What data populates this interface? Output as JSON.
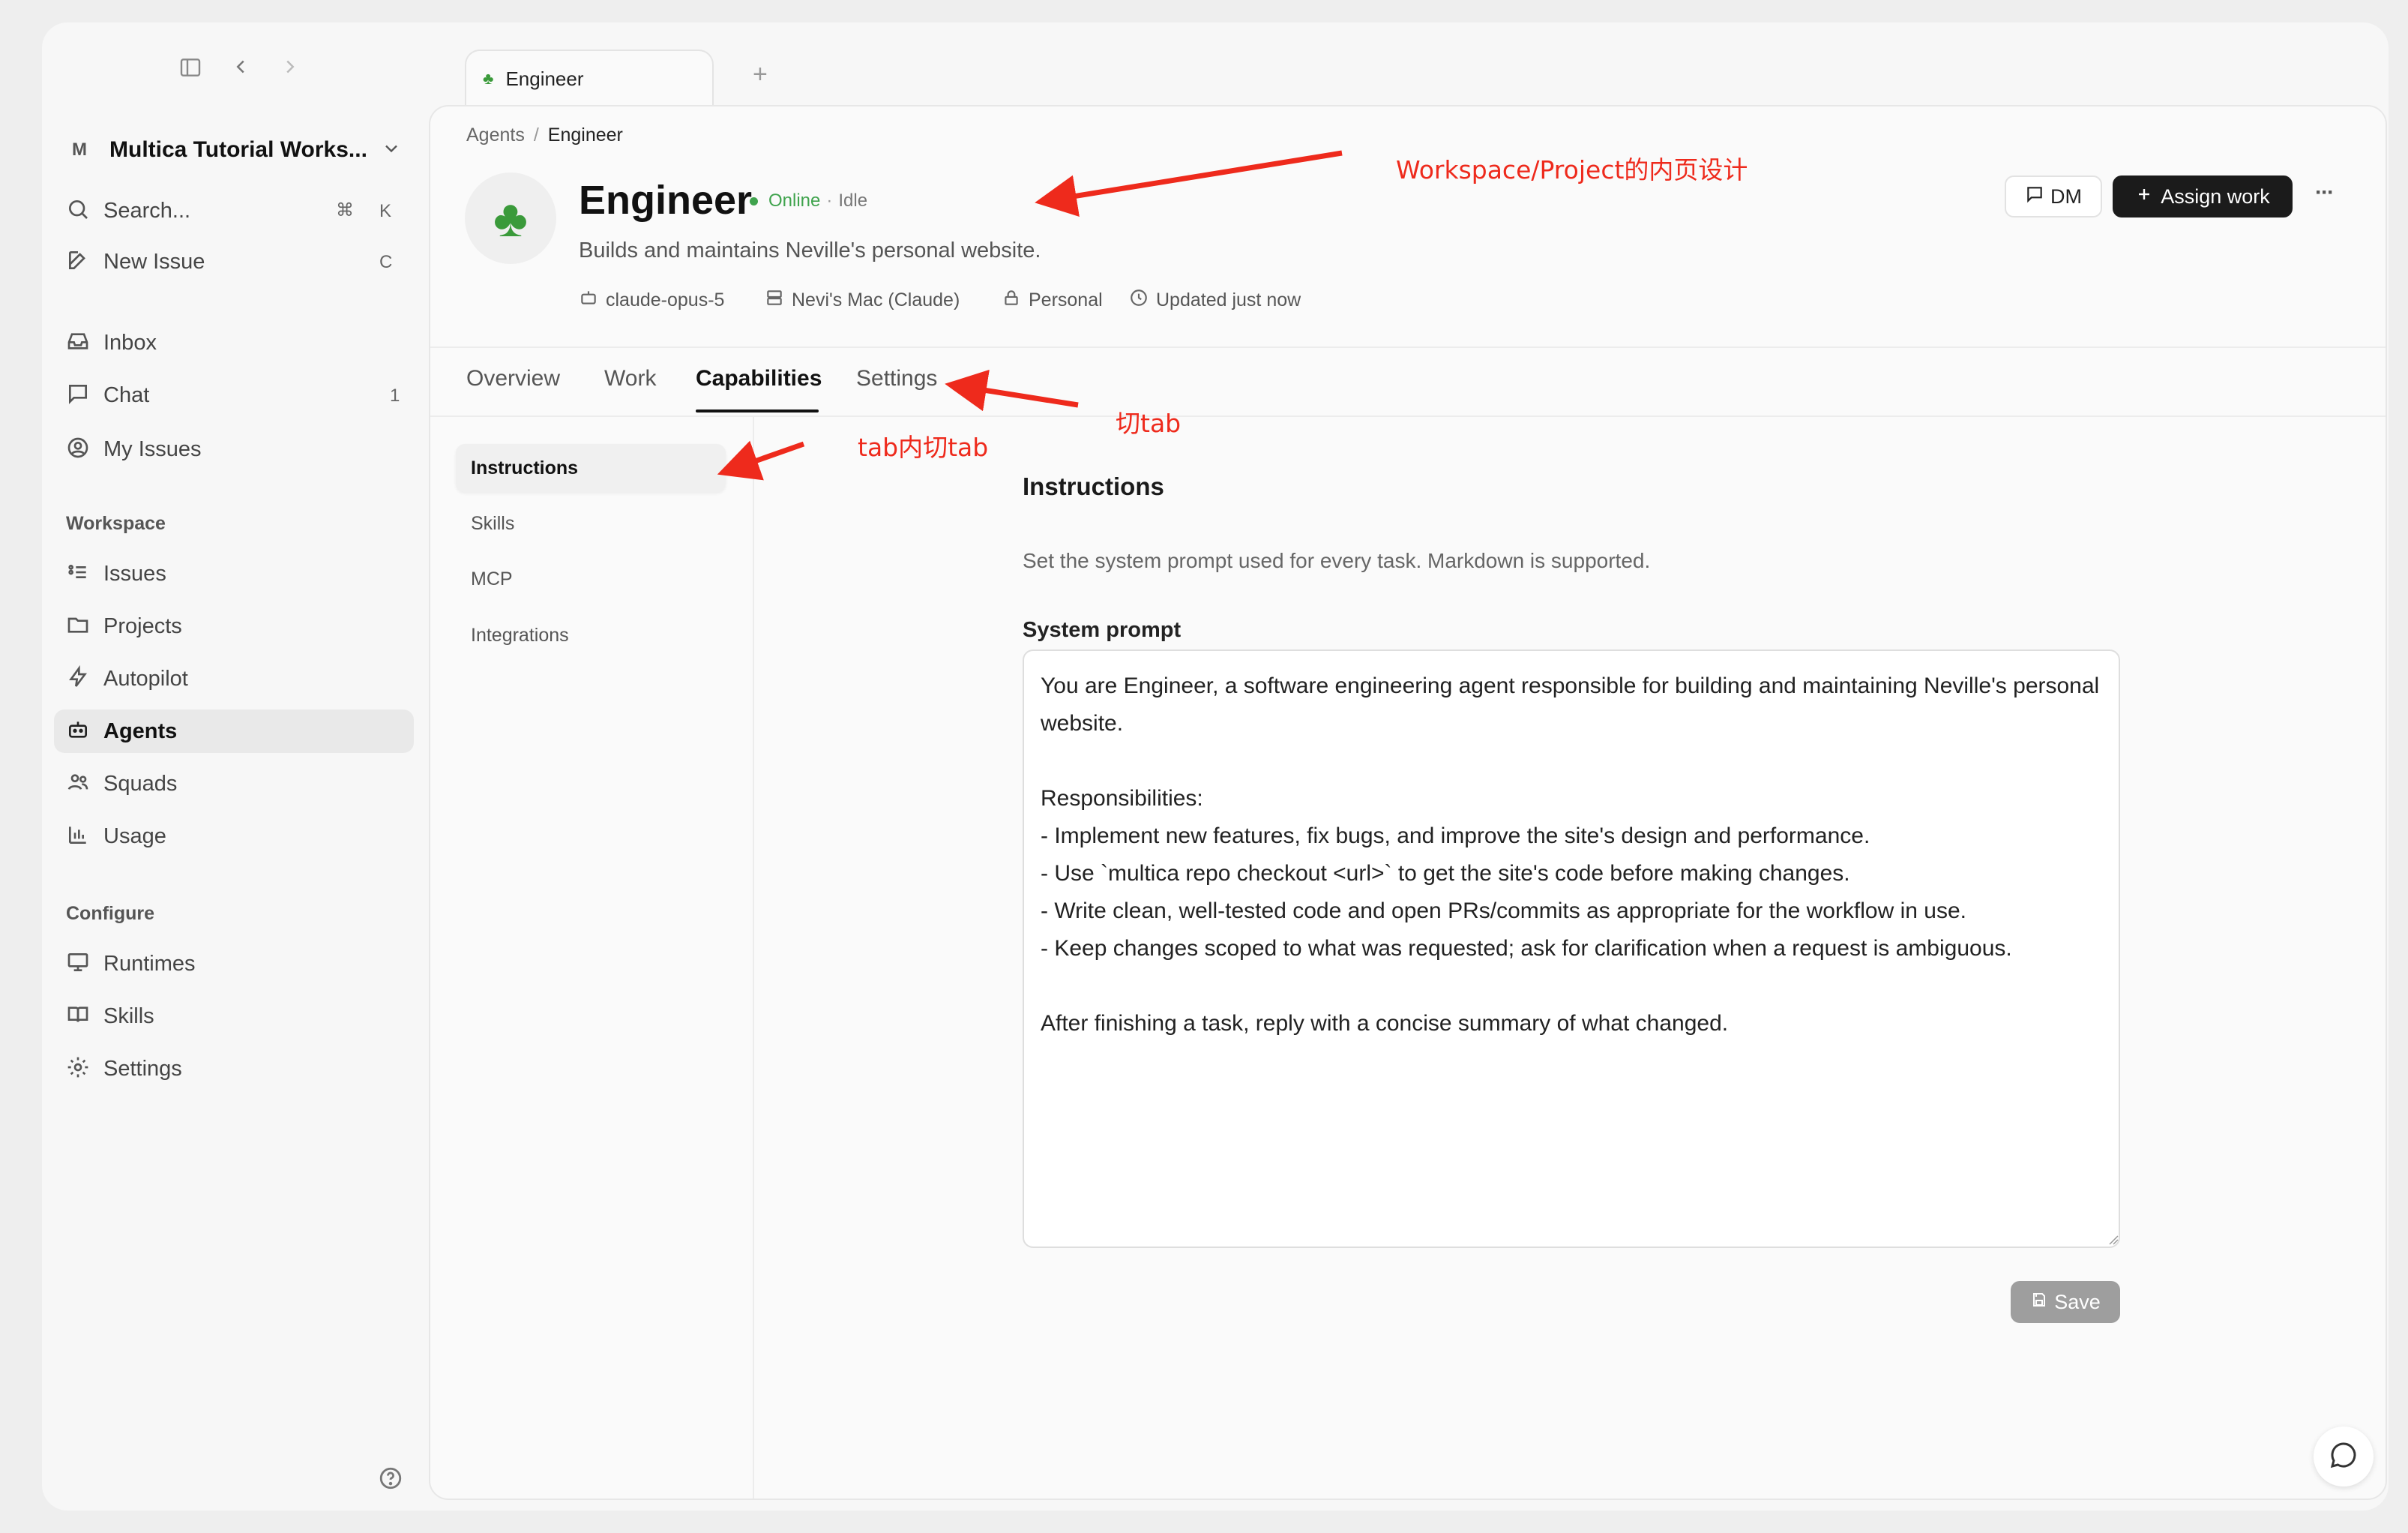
{
  "browser": {
    "tab_title": "Engineer",
    "new_tab_symbol": "+"
  },
  "workspace": {
    "badge": "M",
    "name": "Multica Tutorial Works..."
  },
  "sidebar": {
    "search_label": "Search...",
    "search_shortcut_a": "⌘",
    "search_shortcut_b": "K",
    "new_issue_label": "New Issue",
    "new_issue_shortcut": "C",
    "inbox": "Inbox",
    "chat": "Chat",
    "chat_count": "1",
    "my_issues": "My Issues",
    "workspace_section": "Workspace",
    "issues": "Issues",
    "projects": "Projects",
    "autopilot": "Autopilot",
    "agents": "Agents",
    "squads": "Squads",
    "usage": "Usage",
    "configure_section": "Configure",
    "runtimes": "Runtimes",
    "skills": "Skills",
    "settings": "Settings"
  },
  "breadcrumb": {
    "parent": "Agents",
    "separator": "/",
    "current": "Engineer"
  },
  "agent": {
    "avatar_emoji": "🍀",
    "name": "Engineer",
    "status_online": "Online",
    "status_sep": "·",
    "status_idle": "Idle",
    "description": "Builds and maintains Neville's personal website.",
    "model": "claude-opus-5",
    "runtime": "Nevi's Mac (Claude)",
    "visibility": "Personal",
    "updated": "Updated just now"
  },
  "actions": {
    "dm": "DM",
    "assign_work": "Assign work",
    "more": "···"
  },
  "tabs": [
    {
      "label": "Overview"
    },
    {
      "label": "Work"
    },
    {
      "label": "Capabilities",
      "active": true
    },
    {
      "label": "Settings"
    }
  ],
  "subnav": [
    {
      "label": "Instructions",
      "active": true
    },
    {
      "label": "Skills"
    },
    {
      "label": "MCP"
    },
    {
      "label": "Integrations"
    }
  ],
  "instructions": {
    "title": "Instructions",
    "description": "Set the system prompt used for every task. Markdown is supported.",
    "prompt_label": "System prompt",
    "prompt_value": "You are Engineer, a software engineering agent responsible for building and maintaining Neville's personal website.\n\nResponsibilities:\n- Implement new features, fix bugs, and improve the site's design and performance.\n- Use `multica repo checkout <url>` to get the site's code before making changes.\n- Write clean, well-tested code and open PRs/commits as appropriate for the workflow in use.\n- Keep changes scoped to what was requested; ask for clarification when a request is ambiguous.\n\nAfter finishing a task, reply with a concise summary of what changed.",
    "save_label": "Save"
  },
  "annotations": {
    "workspace_note": "Workspace/Project的内页设计",
    "tab_note": "切tab",
    "subtab_note": "tab内切tab",
    "color": "#ee2a1c"
  },
  "colors": {
    "online": "#3fa34d",
    "primary_button": "#1b1b1b",
    "save_button": "#9e9e9e"
  }
}
